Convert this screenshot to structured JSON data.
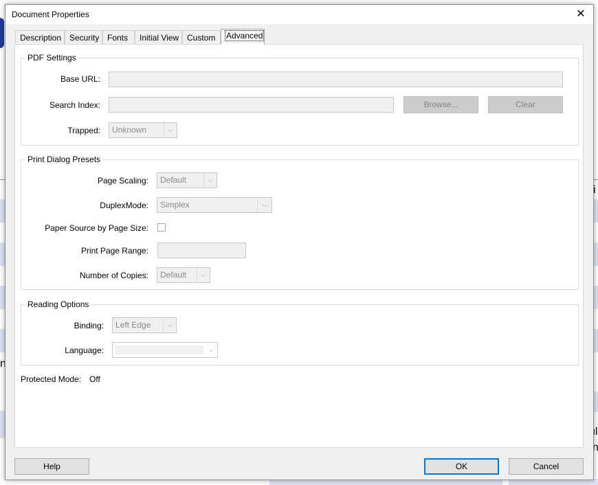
{
  "window": {
    "title": "Document Properties",
    "close_glyph": "✕"
  },
  "tabs": [
    {
      "label": "Description"
    },
    {
      "label": "Security"
    },
    {
      "label": "Fonts"
    },
    {
      "label": "Initial View"
    },
    {
      "label": "Custom"
    },
    {
      "label": "Advanced",
      "active": true
    }
  ],
  "pdf_settings": {
    "title": "PDF Settings",
    "base_url_label": "Base URL:",
    "base_url_value": "",
    "search_index_label": "Search Index:",
    "search_index_value": "",
    "browse_label": "Browse...",
    "clear_label": "Clear",
    "trapped_label": "Trapped:",
    "trapped_value": "Unknown"
  },
  "print_presets": {
    "title": "Print Dialog Presets",
    "page_scaling_label": "Page Scaling:",
    "page_scaling_value": "Default",
    "duplex_label": "DuplexMode:",
    "duplex_value": "Simplex",
    "paper_source_label": "Paper Source by Page Size:",
    "paper_source_checked": false,
    "print_range_label": "Print Page Range:",
    "print_range_value": "",
    "copies_label": "Number of Copies:",
    "copies_value": "Default"
  },
  "reading_options": {
    "title": "Reading Options",
    "binding_label": "Binding:",
    "binding_value": "Left Edge",
    "language_label": "Language:",
    "language_value": ""
  },
  "protected_mode": {
    "label": "Protected Mode:",
    "value": "Off"
  },
  "footer": {
    "help_label": "Help",
    "ok_label": "OK",
    "cancel_label": "Cancel"
  },
  "background": {
    "char_n1": "n",
    "char_n2": "n",
    "char_ul": "ul",
    "char_i": "i"
  },
  "colors": {
    "accent": "#0078d7",
    "disabled_button": "#cccccc",
    "dialog_bg": "#f0f0f0"
  },
  "icons": {
    "close": "close-icon",
    "dropdown": "chevron-down-icon"
  }
}
